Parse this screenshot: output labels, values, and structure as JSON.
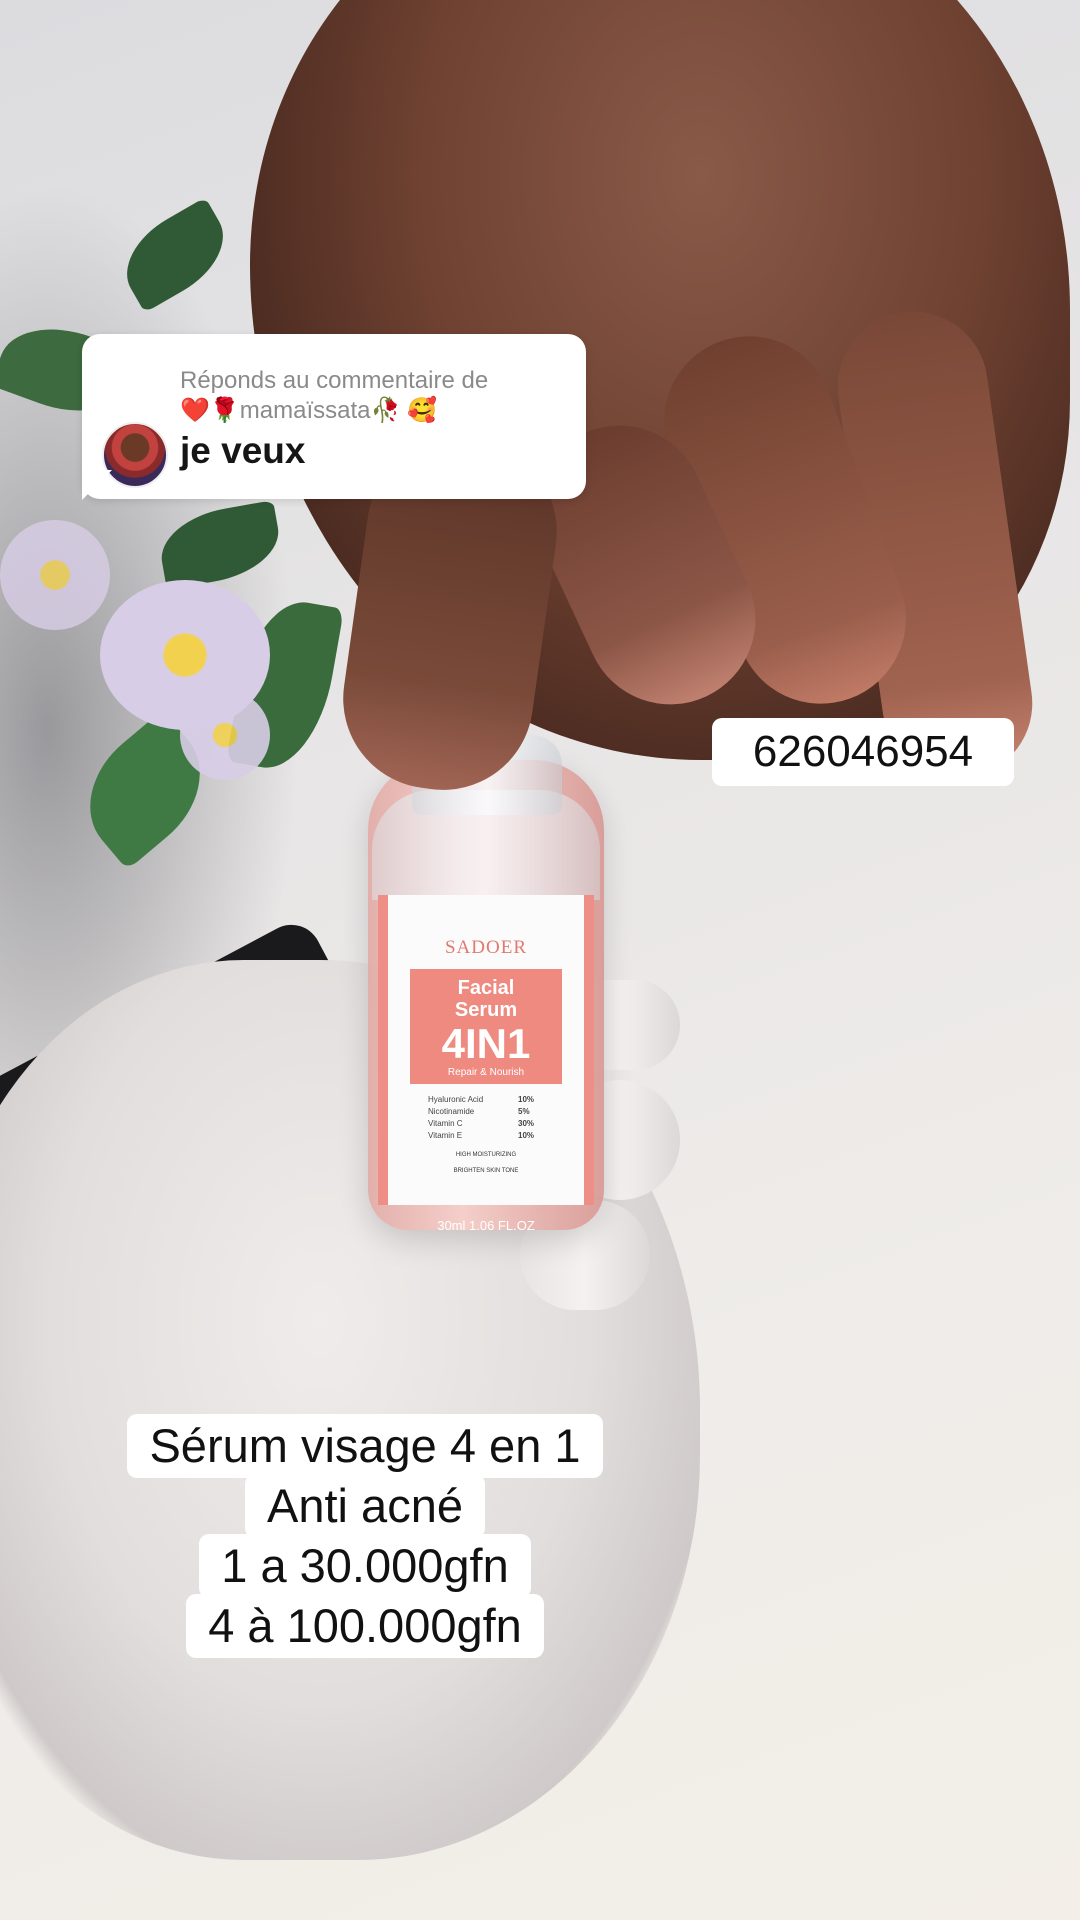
{
  "reply": {
    "header": "Réponds au commentaire de",
    "username": "❤️🌹mamaïssata🥀 🥰",
    "comment": "je veux"
  },
  "phone_tag": "626046954",
  "product_label": {
    "brand": "SADOER",
    "line1": "Facial",
    "line2": "Serum",
    "big": "4IN1",
    "tagline": "Repair & Nourish",
    "ingredients": [
      {
        "name": "Hyaluronic Acid",
        "pct": "10%"
      },
      {
        "name": "Nicotinamide",
        "pct": "5%"
      },
      {
        "name": "Vitamin C",
        "pct": "30%"
      },
      {
        "name": "Vitamin E",
        "pct": "10%"
      }
    ],
    "claim1": "HIGH MOISTURIZING",
    "claim2": "BRIGHTEN SKIN TONE",
    "volume": "30ml 1.06 FL.OZ"
  },
  "caption": {
    "lines": [
      "Sérum visage 4 en 1",
      "Anti acné",
      "1 a 30.000gfn",
      "4 à 100.000gfn"
    ]
  }
}
